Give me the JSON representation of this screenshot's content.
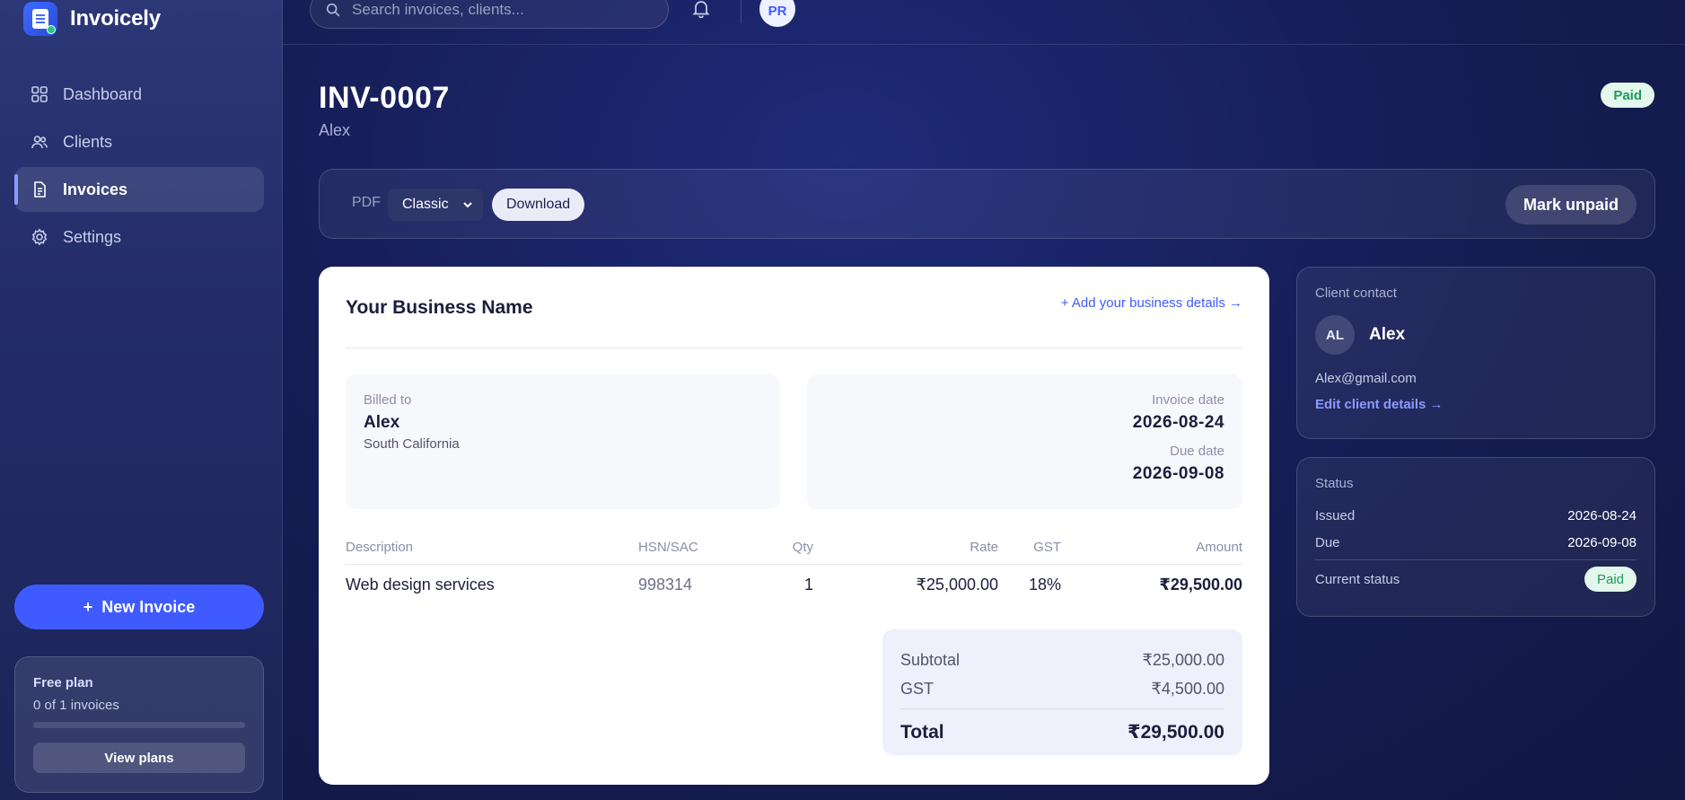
{
  "app": {
    "name": "Invoicely"
  },
  "sidebar": {
    "items": [
      {
        "label": "Dashboard",
        "icon": "dashboard-icon"
      },
      {
        "label": "Clients",
        "icon": "users-icon"
      },
      {
        "label": "Invoices",
        "icon": "document-icon",
        "active": true
      },
      {
        "label": "Settings",
        "icon": "gear-icon"
      }
    ],
    "new_invoice_label": "New Invoice",
    "plan": {
      "title": "Free plan",
      "count": "0 of 1 invoices",
      "used": 0,
      "limit": 1,
      "view_plans_label": "View plans"
    }
  },
  "topbar": {
    "search_placeholder": "Search invoices, clients...",
    "avatar_initials": "PR"
  },
  "invoice": {
    "number": "INV-0007",
    "client_name": "Alex",
    "status_badge": "Paid",
    "toolbar": {
      "pdf_label": "PDF",
      "template_selected": "Classic",
      "download_label": "Download",
      "mark_unpaid_label": "Mark unpaid"
    },
    "business_name": "Your Business Name",
    "add_business_link": "+ Add your business details →",
    "billed_to": {
      "label": "Billed to",
      "name": "Alex",
      "address": "South California"
    },
    "dates": {
      "invoice_label": "Invoice date",
      "invoice_date": "2026-08-24",
      "due_label": "Due date",
      "due_date": "2026-09-08"
    },
    "table": {
      "headers": {
        "description": "Description",
        "hsn": "HSN/SAC",
        "qty": "Qty",
        "rate": "Rate",
        "gst": "GST",
        "amount": "Amount"
      },
      "rows": [
        {
          "description": "Web design services",
          "hsn": "998314",
          "qty": "1",
          "rate": "₹25,000.00",
          "gst": "18%",
          "amount": "₹29,500.00"
        }
      ]
    },
    "totals": {
      "subtotal_label": "Subtotal",
      "subtotal": "₹25,000.00",
      "gst_label": "GST",
      "gst": "₹4,500.00",
      "total_label": "Total",
      "total": "₹29,500.00"
    }
  },
  "client_contact": {
    "title": "Client contact",
    "initials": "AL",
    "name": "Alex",
    "email": "Alex@gmail.com",
    "edit_link": "Edit client details →"
  },
  "status_panel": {
    "title": "Status",
    "issued_label": "Issued",
    "issued": "2026-08-24",
    "due_label": "Due",
    "due": "2026-09-08",
    "current_label": "Current status",
    "current": "Paid"
  },
  "colors": {
    "accent": "#3f5bff",
    "paid_bg": "#e3f7ec",
    "paid_text": "#1f9a5b",
    "background": "#141b4a"
  }
}
